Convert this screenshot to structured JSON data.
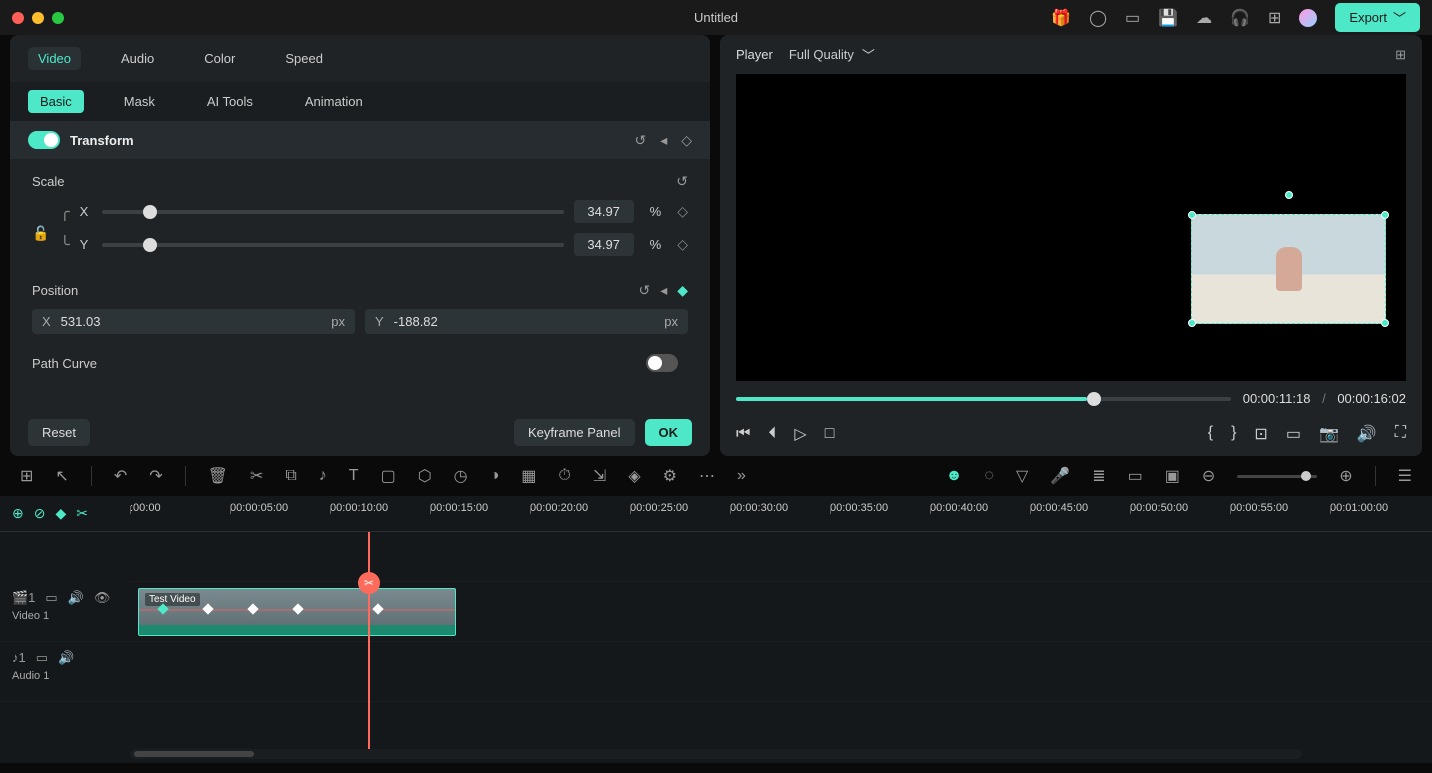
{
  "title": "Untitled",
  "export_label": "Export",
  "tabs_primary": [
    "Video",
    "Audio",
    "Color",
    "Speed"
  ],
  "tabs_primary_active": 0,
  "tabs_secondary": [
    "Basic",
    "Mask",
    "AI Tools",
    "Animation"
  ],
  "tabs_secondary_active": 0,
  "transform": {
    "title": "Transform",
    "scale_label": "Scale",
    "scale_x": "34.97",
    "scale_y": "34.97",
    "scale_unit": "%",
    "position_label": "Position",
    "pos_x": "531.03",
    "pos_y": "-188.82",
    "pos_unit": "px",
    "pathcurve_label": "Path Curve"
  },
  "footer": {
    "reset": "Reset",
    "keyframe_panel": "Keyframe Panel",
    "ok": "OK"
  },
  "player": {
    "label": "Player",
    "quality": "Full Quality",
    "current_time": "00:00:11:18",
    "total_time": "00:00:16:02",
    "progress_pct": 71
  },
  "ruler": [
    ":00:00",
    "00:00:05:00",
    "00:00:10:00",
    "00:00:15:00",
    "00:00:20:00",
    "00:00:25:00",
    "00:00:30:00",
    "00:00:35:00",
    "00:00:40:00",
    "00:00:45:00",
    "00:00:50:00",
    "00:00:55:00",
    "00:01:00:00"
  ],
  "tracks": {
    "video1": "Video 1",
    "audio1": "Audio 1",
    "clip_name": "Test Video"
  }
}
